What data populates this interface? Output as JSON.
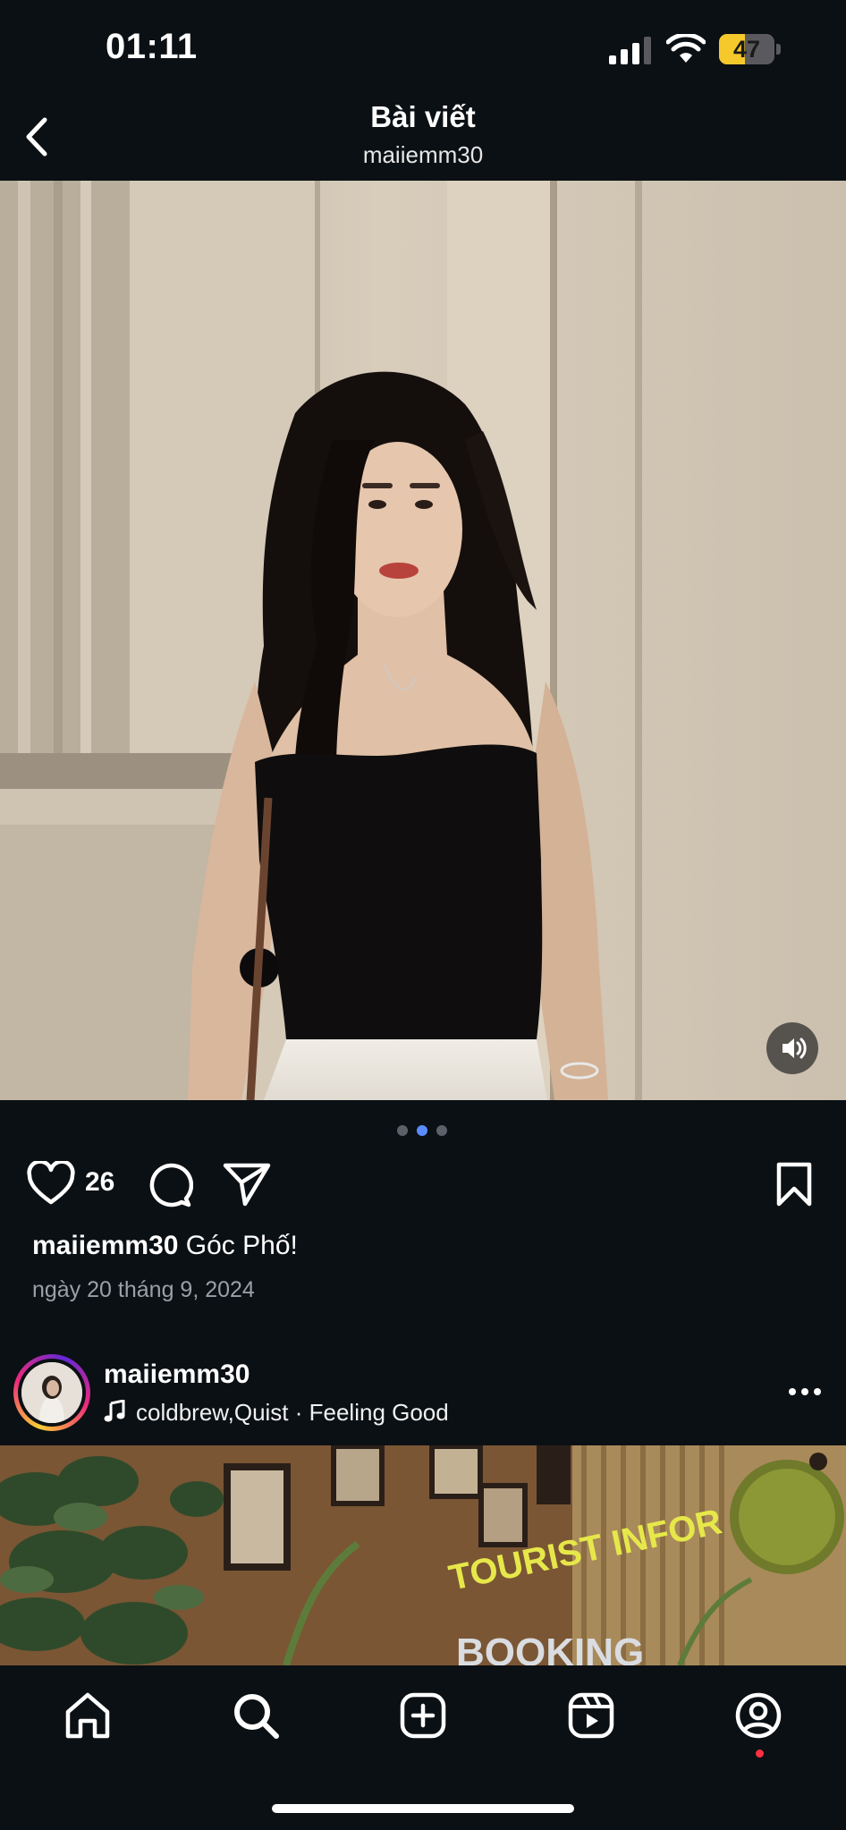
{
  "status_bar": {
    "time": "01:11",
    "battery": "47"
  },
  "header": {
    "title": "Bài viết",
    "subtitle": "maiiemm30"
  },
  "post": {
    "likes": "26",
    "caption_user": "maiiemm30",
    "caption_text": " Góc Phố!",
    "date": "ngày 20 tháng 9, 2024",
    "carousel_total": 3,
    "carousel_active_index": 1
  },
  "next_post": {
    "username": "maiiemm30",
    "music": "coldbrew,Quist · Feeling Good"
  },
  "photo2": {
    "sign_text": "TOURIST INFOR",
    "sign_text2": "BOOKING"
  },
  "colors": {
    "background": "#0b1014",
    "accent": "#5b8cff",
    "badge": "#ff3040",
    "battery": "#f5c92c"
  }
}
